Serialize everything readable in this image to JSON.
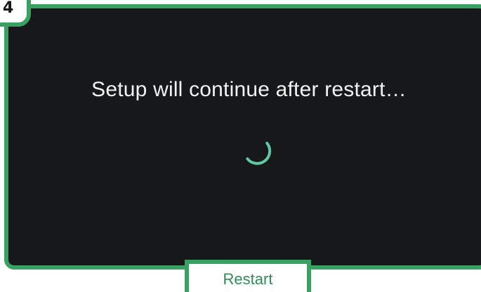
{
  "step": {
    "number": "4"
  },
  "screen": {
    "message": "Setup will continue after restart…"
  },
  "spinner": {
    "icon": "loading-spinner-icon",
    "color": "#5fc9a3"
  },
  "callout": {
    "restart_label": "Restart"
  },
  "colors": {
    "frame": "#3aa164",
    "screen_background": "#17181a",
    "message_text": "#f2f2f2",
    "callout_text": "#2f8e56"
  }
}
